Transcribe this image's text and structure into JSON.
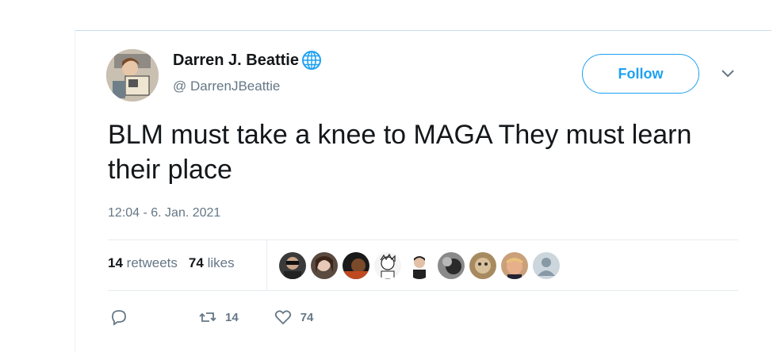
{
  "user": {
    "display_name": "Darren J. Beattie",
    "handle": "@ DarrenJBeattie",
    "follow_label": "Follow"
  },
  "tweet": {
    "text": "BLM must take a knee to MAGA They must learn their place",
    "timestamp": "12:04 - 6. Jan. 2021"
  },
  "stats": {
    "retweets_count": "14",
    "retweets_label": "retweets",
    "likes_count": "74",
    "likes_label": "likes"
  },
  "actions": {
    "retweet_count": "14",
    "like_count": "74"
  },
  "colors": {
    "accent": "#1da1f2",
    "secondary_text": "#657786",
    "divider": "#e6ecf0"
  },
  "liker_avatars": [
    "avatar-1",
    "avatar-2",
    "avatar-3",
    "avatar-4",
    "avatar-5",
    "avatar-6",
    "avatar-7",
    "avatar-8",
    "avatar-default"
  ]
}
